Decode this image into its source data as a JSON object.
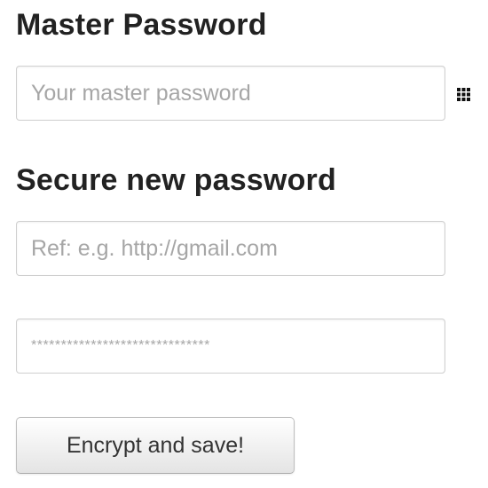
{
  "master": {
    "heading": "Master Password",
    "placeholder": "Your master password",
    "icon": "grid-icon"
  },
  "secure": {
    "heading": "Secure new password",
    "ref_placeholder": "Ref: e.g. http://gmail.com",
    "generated_value": "******************************"
  },
  "actions": {
    "encrypt_label": "Encrypt and save!"
  },
  "colors": {
    "heading": "#222222",
    "placeholder": "#a6a6a6",
    "border": "#cfcfcf"
  }
}
